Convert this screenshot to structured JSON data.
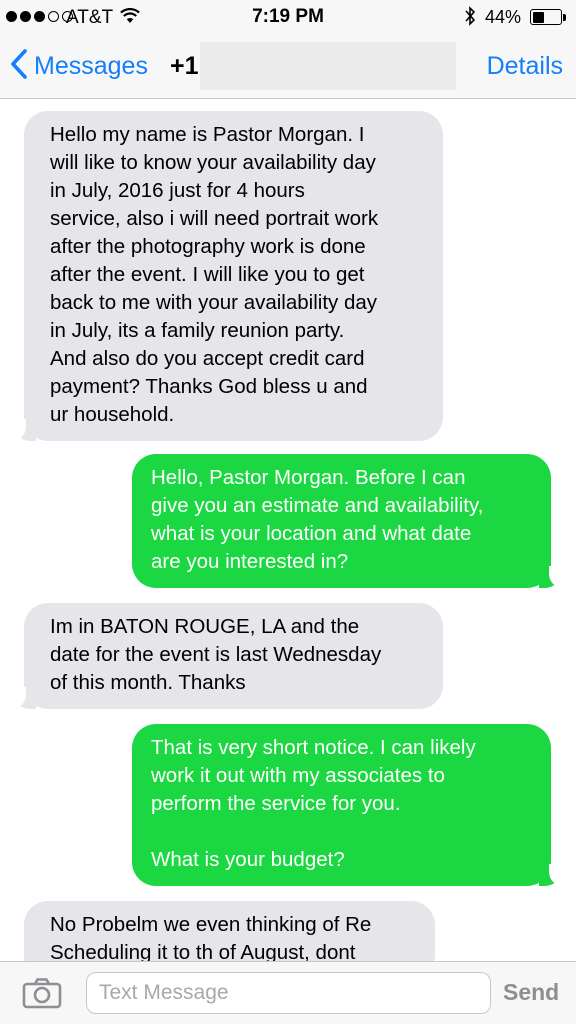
{
  "status_bar": {
    "carrier": "AT&T",
    "time": "7:19 PM",
    "battery": "44%",
    "battery_level": 0.44,
    "signal_bars_filled": 3,
    "signal_bars_total": 5
  },
  "nav": {
    "back_label": "Messages",
    "contact": "+1",
    "details_label": "Details"
  },
  "messages": [
    {
      "direction": "incoming",
      "text": "Hello my name is Pastor Morgan. I\nwill like to know your availability day\nin July, 2016 just for 4 hours\nservice, also i will need portrait work\nafter the photography work is done\nafter the event. I will like you to get\nback to me with your availability day\nin July, its a family reunion party.\nAnd also do you accept credit card\npayment? Thanks God bless u and\nur household."
    },
    {
      "direction": "outgoing",
      "text": "Hello, Pastor Morgan. Before I can\ngive you an estimate and availability,\nwhat is your location and what date\nare you interested in?"
    },
    {
      "direction": "incoming",
      "text": "Im in BATON ROUGE, LA and the\ndate for the event is last Wednesday\nof this month. Thanks"
    },
    {
      "direction": "outgoing",
      "text": "That is very short notice. I can likely\nwork it out with my associates to\nperform the service for you.\n\nWhat is your budget?"
    },
    {
      "direction": "incoming",
      "text": "No Probelm we even thinking of Re\nScheduling it to  th of August, dont"
    }
  ],
  "composer": {
    "placeholder": "Text Message",
    "value": "",
    "send_label": "Send"
  },
  "colors": {
    "accent": "#147efb",
    "incoming_bubble": "#e5e5ea",
    "outgoing_bubble": "#1bd741"
  }
}
